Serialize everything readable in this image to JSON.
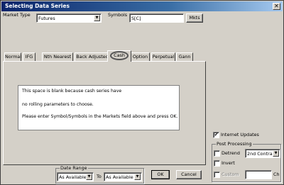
{
  "window": {
    "title": "Selecting Data Series",
    "close_glyph": "✕"
  },
  "market_type": {
    "label": "Market Type",
    "value": "Futures"
  },
  "symbols": {
    "label": "Symbols",
    "value": "S[C]",
    "button": "Mkts"
  },
  "tabs": [
    {
      "label": "Normal"
    },
    {
      "label": "IFG"
    },
    {
      "label": "Nth Nearest"
    },
    {
      "label": "Back Adjusted"
    },
    {
      "label": "Cash"
    },
    {
      "label": "Option"
    },
    {
      "label": "Perpetual"
    },
    {
      "label": "Gann"
    }
  ],
  "active_tab": "Cash",
  "info": {
    "line1": "This space is blank because cash series have",
    "line2": "no rolling parameters to choose.",
    "line3": "Please enter Symbol/Symbols in the Markets field above and press OK."
  },
  "internet_updates": {
    "label": "Internet Updates",
    "checked": true,
    "mark": "✔"
  },
  "post_processing": {
    "title": "Post Processing",
    "detrend": {
      "label": "Detrend",
      "checked": false
    },
    "detrend_select": "2nd Contra",
    "invert": {
      "label": "Invert",
      "checked": false
    },
    "custom": {
      "label": "Custom",
      "checked": false,
      "value": "",
      "button": "Ch"
    }
  },
  "date_range": {
    "title": "Date Range",
    "from": "As Available",
    "to_label": "To",
    "to": "As Available"
  },
  "buttons": {
    "ok": "OK",
    "cancel": "Cancel"
  },
  "dropdown_glyph": "▼"
}
